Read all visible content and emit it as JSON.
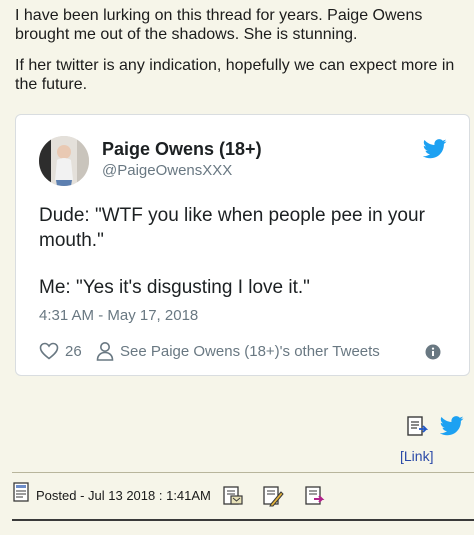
{
  "post": {
    "paragraph_1": "I have been lurking on this thread for years. Paige Owens brought me out of the shadows. She is stunning.",
    "paragraph_2": "If her twitter is any indication, hopefully we can expect more in the future."
  },
  "tweet": {
    "author_name": "Paige Owens (18+)",
    "author_handle": "@PaigeOwensXXX",
    "body_line_1": "Dude: \"WTF you like when people pee in your mouth.\"",
    "body_line_2": "Me: \"Yes it's disgusting I love it.\"",
    "timestamp": "4:31 AM - May 17, 2018",
    "like_count": "26",
    "other_tweets_label": "See Paige Owens (18+)'s other Tweets",
    "brand_color": "#1da1f2",
    "icons": [
      "twitter-bird-icon",
      "heart-icon",
      "person-icon",
      "info-icon"
    ]
  },
  "share": {
    "link_label": "[Link]",
    "icons": [
      "document-icon",
      "twitter-bird-icon"
    ]
  },
  "footer": {
    "posted_label": "Posted - Jul 13 2018 :  1:41AM",
    "icons": [
      "post-icon",
      "reply-with-quote-icon",
      "edit-icon",
      "report-icon"
    ]
  }
}
